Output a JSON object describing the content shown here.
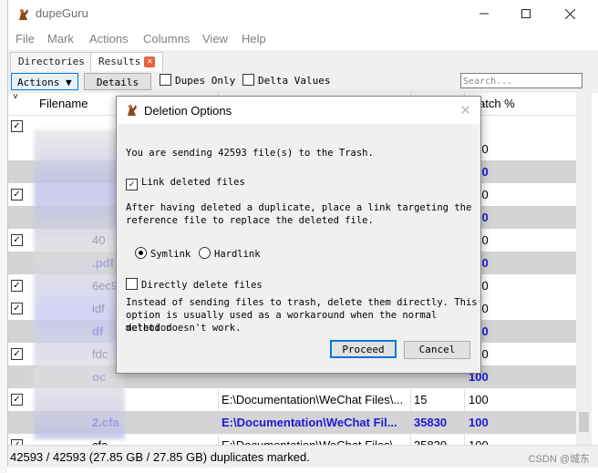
{
  "window": {
    "title": "dupeGuru"
  },
  "menu": [
    "File",
    "Mark",
    "Actions",
    "Columns",
    "View",
    "Help"
  ],
  "tabs": [
    {
      "label": "Directories"
    },
    {
      "label": "Results"
    }
  ],
  "toolbar": {
    "actions_label": "Actions ▼",
    "details_label": "Details",
    "dupes_only_label": "Dupes Only",
    "delta_values_label": "Delta Values",
    "search_placeholder": "Search..."
  },
  "columns": [
    "Filename",
    "atch %"
  ],
  "rows": [
    {
      "checked": true,
      "ref": false,
      "name": "",
      "folder": "",
      "size": "",
      "match": ""
    },
    {
      "checked": false,
      "ref": false,
      "name": "",
      "folder": "",
      "size": "",
      "match": "100"
    },
    {
      "checked": false,
      "ref": true,
      "name": "",
      "folder": "",
      "size": "",
      "match": "100"
    },
    {
      "checked": true,
      "ref": false,
      "name": "",
      "folder": "",
      "size": "",
      "match": "100"
    },
    {
      "checked": false,
      "ref": true,
      "name": "",
      "folder": "",
      "size": "",
      "match": "100"
    },
    {
      "checked": true,
      "ref": false,
      "name": "40",
      "folder": "",
      "size": "",
      "match": "100"
    },
    {
      "checked": false,
      "ref": true,
      "name": ".pdf",
      "folder": "",
      "size": "",
      "match": "100"
    },
    {
      "checked": true,
      "ref": false,
      "name": "6ec9",
      "folder": "",
      "size": "",
      "match": "100"
    },
    {
      "checked": true,
      "ref": false,
      "name": "idf",
      "folder": "",
      "size": "",
      "match": "100"
    },
    {
      "checked": false,
      "ref": true,
      "name": "df",
      "folder": "",
      "size": "",
      "match": "100"
    },
    {
      "checked": true,
      "ref": false,
      "name": "fdc",
      "folder": "",
      "size": "",
      "match": "100"
    },
    {
      "checked": false,
      "ref": true,
      "name": "oc",
      "folder": "",
      "size": "",
      "match": "100"
    },
    {
      "checked": true,
      "ref": false,
      "name": "",
      "folder": "E:\\Documentation\\WeChat Files\\...",
      "size": "15",
      "match": "100"
    },
    {
      "checked": false,
      "ref": true,
      "name": "2.cfa",
      "folder": "E:\\Documentation\\WeChat Fil...",
      "size": "35830",
      "match": "100"
    },
    {
      "checked": true,
      "ref": false,
      "name": "cfa",
      "folder": "E:\\Documentation\\WeChat Files\\...",
      "size": "35830",
      "match": "100"
    }
  ],
  "status": {
    "text": "42593 / 42593 (27.85 GB / 27.85 GB) duplicates marked.",
    "watermark": "CSDN @城东"
  },
  "dialog": {
    "title": "Deletion Options",
    "message": "You are sending 42593 file(s) to the Trash.",
    "link_deleted_label": "Link deleted files",
    "link_desc_1": "After having deleted a duplicate, place a link targeting the",
    "link_desc_2": "reference file to replace the deleted file.",
    "symlink_label": "Symlink",
    "hardlink_label": "Hardlink",
    "direct_delete_label": "Directly delete files",
    "direct_desc_1": "Instead of sending files to trash, delete them directly. This",
    "direct_desc_2": "option is usually used as a workaround when the normal deletion",
    "direct_desc_3": "method doesn't work.",
    "proceed_label": "Proceed",
    "cancel_label": "Cancel",
    "link_deleted_checked": true,
    "symlink_selected": true,
    "direct_delete_checked": false
  },
  "colors": {
    "reference_text": "#1a1ad6",
    "alt_row": "#d4d4d4",
    "accent": "#0078d7"
  }
}
